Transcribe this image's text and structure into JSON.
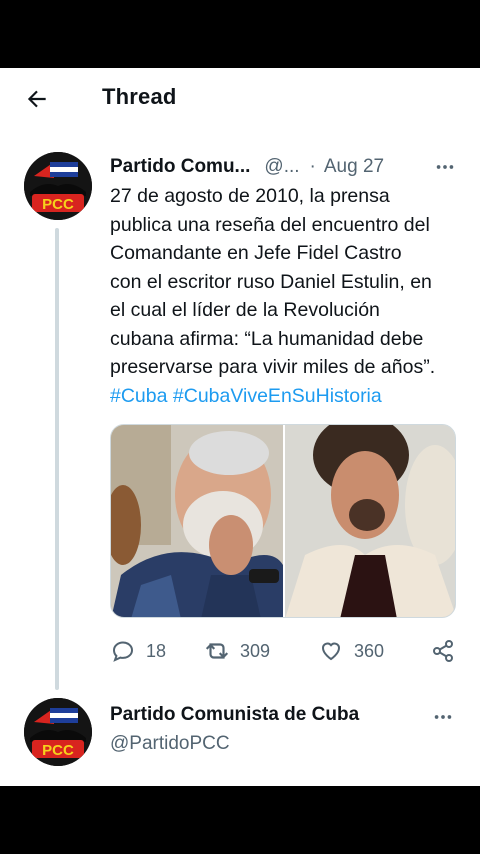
{
  "header": {
    "title": "Thread"
  },
  "tweet": {
    "name": "Partido Comu...",
    "handle": "@...",
    "separator": "·",
    "date": "Aug 27",
    "text_lines": [
      "27 de agosto de 2010, la prensa",
      "publica una reseña del encuentro del",
      "Comandante en Jefe Fidel Castro",
      "con el escritor ruso Daniel Estulin, en",
      "el cual el líder de la Revolución",
      "cubana afirma: “La humanidad debe",
      "preservarse para vivir miles de años”."
    ],
    "hashtags": [
      "#Cuba",
      "#CubaViveEnSuHistoria"
    ],
    "media_count": 2,
    "stats": {
      "replies": "18",
      "retweets": "309",
      "likes": "360"
    }
  },
  "reply_account": {
    "name": "Partido Comunista de Cuba",
    "handle": "@PartidoPCC"
  },
  "avatar_label": "PCC",
  "colors": {
    "accent": "#1d9bf0",
    "text": "#0f1419",
    "muted": "#536471",
    "divider": "#cfd9de",
    "logo_red": "#d8241f",
    "logo_blue": "#1e3e9a"
  }
}
